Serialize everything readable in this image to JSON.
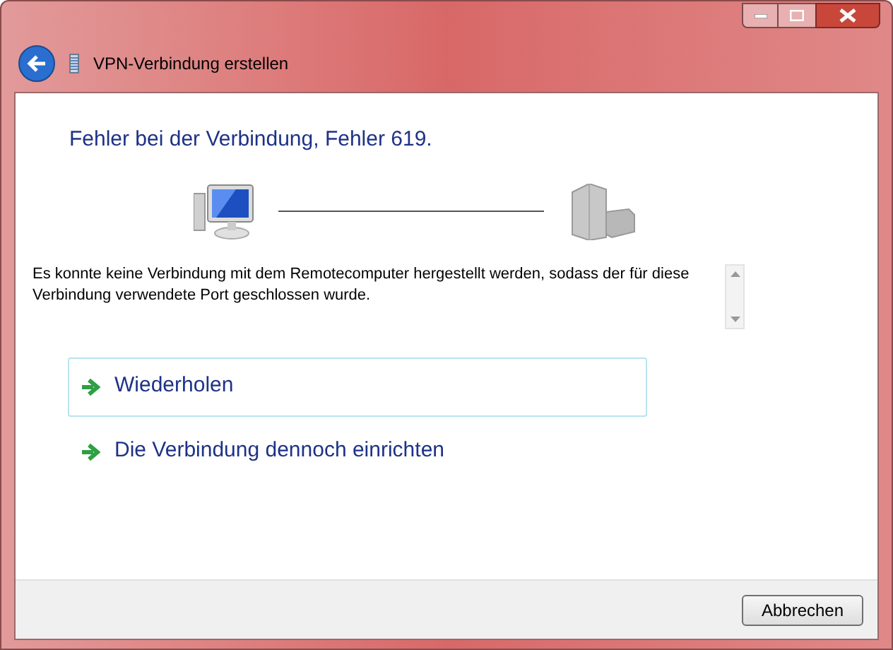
{
  "window": {
    "title": "VPN-Verbindung erstellen"
  },
  "heading": "Fehler bei der Verbindung, Fehler 619.",
  "message": "Es konnte keine Verbindung mit dem Remotecomputer hergestellt werden, sodass der für diese Verbindung verwendete Port geschlossen wurde.",
  "options": [
    {
      "label": "Wiederholen",
      "selected": true
    },
    {
      "label": "Die Verbindung dennoch einrichten",
      "selected": false
    }
  ],
  "buttons": [
    "Abbrechen"
  ]
}
